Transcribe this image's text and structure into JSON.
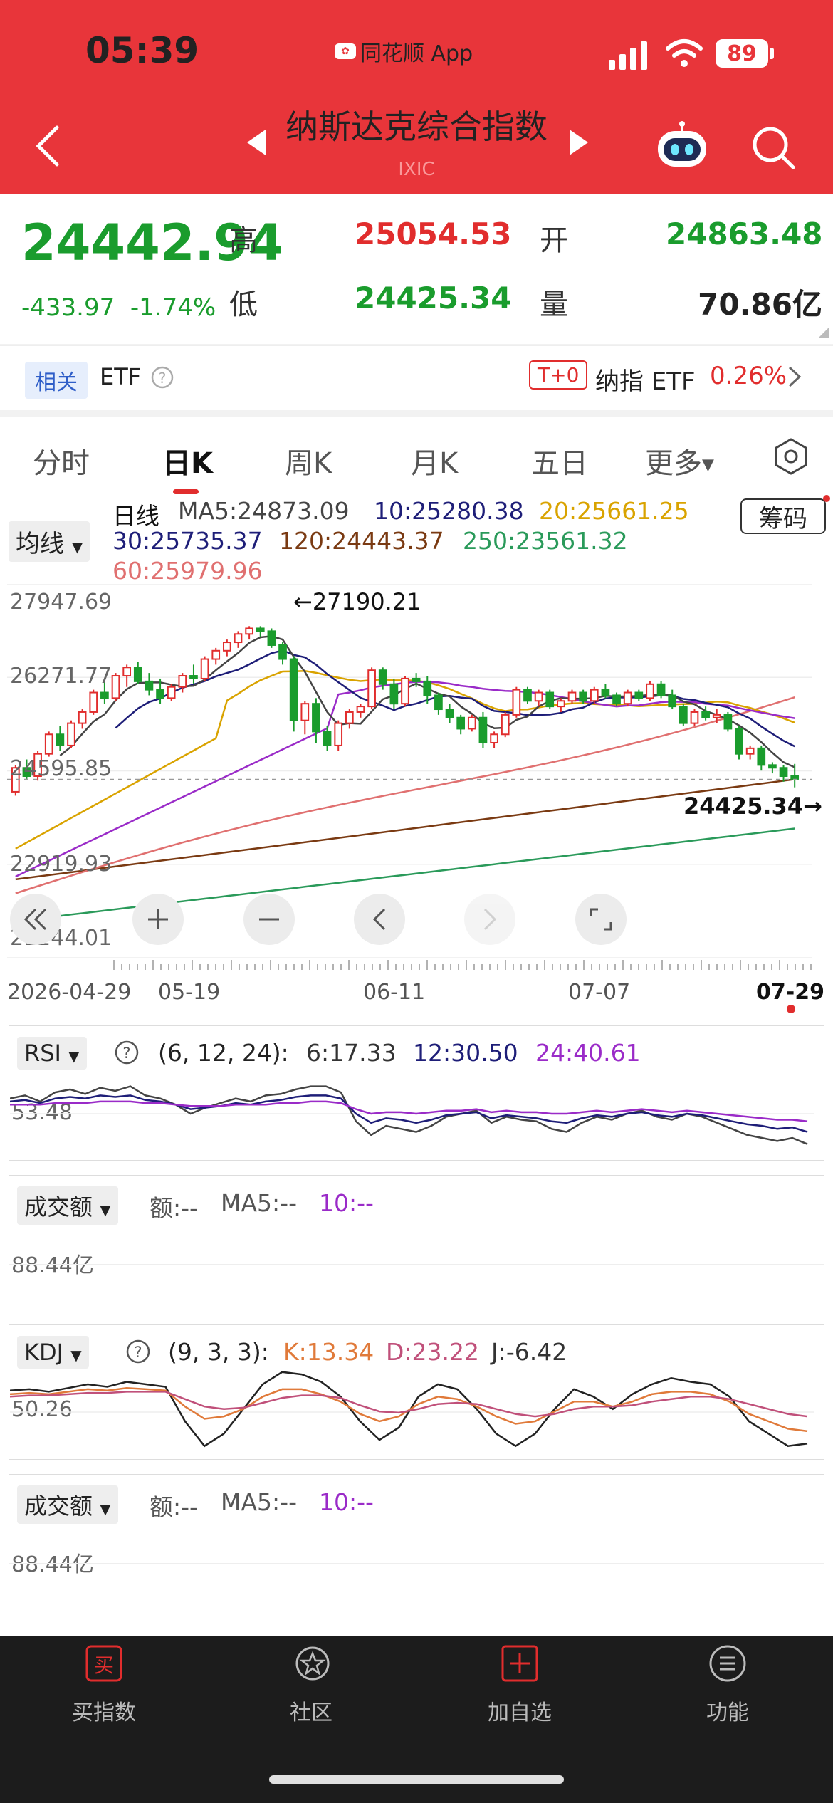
{
  "status_bar": {
    "time": "05:39",
    "app_badge": "同花顺 App",
    "battery": "89"
  },
  "header": {
    "title": "纳斯达克综合指数",
    "subtitle": "IXIC"
  },
  "quote": {
    "price": "24442.94",
    "change": "-433.97",
    "change_pct": "-1.74%",
    "high_label": "高",
    "high": "25054.53",
    "open_label": "开",
    "open": "24863.48",
    "low_label": "低",
    "low": "24425.34",
    "volume_label": "量",
    "volume": "70.86亿"
  },
  "etf_bar": {
    "related": "相关",
    "etf": "ETF",
    "t0": "T+0",
    "name": "纳指 ETF",
    "change": "0.26%"
  },
  "tabs": [
    "分时",
    "日K",
    "周K",
    "月K",
    "五日",
    "更多"
  ],
  "active_tab": "日K",
  "ma_bar": {
    "selector": "均线",
    "period": "日线",
    "ma5": "MA5:24873.09",
    "ma10": "10:25280.38",
    "ma20": "20:25661.25",
    "ma30": "30:25735.37",
    "ma120": "120:24443.37",
    "ma250": "250:23561.32",
    "ma60": "60:25979.96",
    "chips": "筹码"
  },
  "colors": {
    "ma5": "#444444",
    "ma10": "#1e1e78",
    "ma20": "#d9a300",
    "ma30": "#9a2bc8",
    "ma60": "#e07070",
    "ma120": "#7a3a12",
    "ma250": "#2a9a5a",
    "up": "#e12d2d",
    "down": "#1a9c2d"
  },
  "chart_data": [
    {
      "type": "candlestick",
      "y_ticks": [
        "27947.69",
        "26271.77",
        "24595.85",
        "22919.93",
        "21244.01"
      ],
      "x_ticks": [
        "2026-04-29",
        "05-19",
        "06-11",
        "07-07",
        "07-29"
      ],
      "ylim": [
        21244.01,
        27947.69
      ],
      "annotations": {
        "high": "←27190.21",
        "low": "24425.34→"
      },
      "ohlc": [
        [
          24220,
          24700,
          24150,
          24650
        ],
        [
          24650,
          24800,
          24450,
          24500
        ],
        [
          24500,
          24950,
          24420,
          24900
        ],
        [
          24900,
          25300,
          24850,
          25250
        ],
        [
          25250,
          25400,
          24950,
          25050
        ],
        [
          25050,
          25500,
          25000,
          25450
        ],
        [
          25450,
          25700,
          25350,
          25650
        ],
        [
          25650,
          26050,
          25600,
          26000
        ],
        [
          26000,
          26200,
          25800,
          25900
        ],
        [
          25900,
          26350,
          25850,
          26300
        ],
        [
          26300,
          26500,
          26100,
          26450
        ],
        [
          26450,
          26550,
          26150,
          26200
        ],
        [
          26200,
          26350,
          25950,
          26050
        ],
        [
          26050,
          26250,
          25800,
          25900
        ],
        [
          25900,
          26150,
          25850,
          26100
        ],
        [
          26100,
          26350,
          26000,
          26300
        ],
        [
          26300,
          26500,
          26150,
          26250
        ],
        [
          26250,
          26650,
          26200,
          26600
        ],
        [
          26600,
          26800,
          26500,
          26750
        ],
        [
          26750,
          26950,
          26650,
          26900
        ],
        [
          26900,
          27100,
          26800,
          27050
        ],
        [
          27050,
          27190,
          26950,
          27150
        ],
        [
          27150,
          27190,
          27000,
          27100
        ],
        [
          27100,
          27150,
          26800,
          26850
        ],
        [
          26850,
          26900,
          26500,
          26600
        ],
        [
          26600,
          26650,
          25300,
          25500
        ],
        [
          25500,
          25850,
          25250,
          25800
        ],
        [
          25800,
          25900,
          25100,
          25300
        ],
        [
          25300,
          25400,
          24950,
          25050
        ],
        [
          25050,
          25500,
          24950,
          25450
        ],
        [
          25450,
          25700,
          25350,
          25650
        ],
        [
          25650,
          25800,
          25550,
          25750
        ],
        [
          25750,
          26450,
          25700,
          26400
        ],
        [
          26400,
          26450,
          26050,
          26150
        ],
        [
          26150,
          26250,
          25700,
          25800
        ],
        [
          25800,
          26300,
          25750,
          26250
        ],
        [
          26250,
          26350,
          26100,
          26200
        ],
        [
          26200,
          26300,
          25800,
          25950
        ],
        [
          25950,
          26000,
          25600,
          25700
        ],
        [
          25700,
          25800,
          25450,
          25550
        ],
        [
          25550,
          25600,
          25250,
          25350
        ],
        [
          25350,
          25600,
          25300,
          25550
        ],
        [
          25550,
          25650,
          25000,
          25100
        ],
        [
          25100,
          25300,
          25000,
          25250
        ],
        [
          25250,
          25650,
          25200,
          25600
        ],
        [
          25600,
          26100,
          25550,
          26050
        ],
        [
          26050,
          26100,
          25800,
          25850
        ],
        [
          25850,
          26050,
          25750,
          26000
        ],
        [
          26000,
          26050,
          25700,
          25750
        ],
        [
          25750,
          25900,
          25650,
          25850
        ],
        [
          25850,
          26050,
          25800,
          26000
        ],
        [
          26000,
          26050,
          25800,
          25850
        ],
        [
          25850,
          26100,
          25800,
          26050
        ],
        [
          26050,
          26150,
          25900,
          25950
        ],
        [
          25950,
          26000,
          25750,
          25800
        ],
        [
          25800,
          26050,
          25750,
          26000
        ],
        [
          26000,
          26050,
          25850,
          25900
        ],
        [
          25900,
          26200,
          25850,
          26150
        ],
        [
          26150,
          26200,
          25900,
          25950
        ],
        [
          25950,
          26050,
          25700,
          25750
        ],
        [
          25750,
          25800,
          25400,
          25450
        ],
        [
          25450,
          25700,
          25400,
          25650
        ],
        [
          25650,
          25750,
          25500,
          25550
        ],
        [
          25550,
          25700,
          25450,
          25600
        ],
        [
          25600,
          25650,
          25300,
          25350
        ],
        [
          25350,
          25400,
          24800,
          24900
        ],
        [
          24900,
          25050,
          24800,
          25000
        ],
        [
          25000,
          25050,
          24600,
          24700
        ],
        [
          24700,
          24750,
          24550,
          24650
        ],
        [
          24650,
          24700,
          24400,
          24500
        ],
        [
          24500,
          24720,
          24300,
          24450
        ]
      ]
    },
    {
      "type": "line",
      "name": "RSI",
      "params": "(6, 12, 24):",
      "rsi6": "6:17.33",
      "rsi12": "12:30.50",
      "rsi24": "24:40.61",
      "y_label": "53.48",
      "series": [
        {
          "name": "6",
          "values": [
            60,
            62,
            58,
            64,
            66,
            63,
            67,
            65,
            68,
            62,
            60,
            56,
            50,
            54,
            57,
            60,
            58,
            62,
            63,
            66,
            68,
            68,
            64,
            45,
            36,
            42,
            40,
            38,
            42,
            48,
            50,
            52,
            44,
            48,
            46,
            45,
            40,
            38,
            44,
            48,
            46,
            50,
            52,
            48,
            46,
            50,
            48,
            44,
            40,
            36,
            34,
            32,
            34,
            30
          ]
        },
        {
          "name": "12",
          "values": [
            58,
            59,
            57,
            60,
            61,
            60,
            62,
            61,
            62,
            59,
            58,
            56,
            53,
            54,
            55,
            57,
            56,
            58,
            59,
            61,
            62,
            62,
            60,
            50,
            44,
            47,
            46,
            44,
            46,
            49,
            50,
            51,
            47,
            49,
            48,
            47,
            45,
            44,
            47,
            49,
            48,
            50,
            51,
            49,
            48,
            50,
            49,
            47,
            45,
            43,
            42,
            40,
            41,
            38
          ]
        },
        {
          "name": "24",
          "values": [
            56,
            56,
            56,
            57,
            57,
            57,
            58,
            58,
            58,
            57,
            57,
            56,
            55,
            55,
            55,
            56,
            56,
            56,
            57,
            57,
            58,
            58,
            57,
            53,
            50,
            51,
            51,
            50,
            51,
            52,
            52,
            53,
            51,
            52,
            51,
            51,
            50,
            50,
            51,
            52,
            51,
            52,
            53,
            52,
            51,
            52,
            51,
            50,
            49,
            48,
            47,
            46,
            46,
            45
          ]
        }
      ]
    },
    {
      "type": "bar",
      "name": "成交额",
      "label_amount": "额:--",
      "label_ma5": "MA5:--",
      "label_ma10": "10:--",
      "y_label": "88.44亿",
      "values": []
    },
    {
      "type": "line",
      "name": "KDJ",
      "params": "(9, 3, 3):",
      "k": "K:13.34",
      "d": "D:23.22",
      "j": "J:-6.42",
      "y_label": "50.26",
      "series": [
        {
          "name": "J",
          "values": [
            65,
            66,
            64,
            67,
            70,
            68,
            72,
            70,
            68,
            40,
            20,
            30,
            50,
            70,
            80,
            78,
            72,
            60,
            40,
            25,
            35,
            60,
            70,
            66,
            50,
            30,
            20,
            30,
            50,
            66,
            60,
            50,
            62,
            70,
            75,
            72,
            70,
            60,
            40,
            30,
            20,
            22
          ]
        },
        {
          "name": "K",
          "values": [
            62,
            63,
            62,
            64,
            66,
            65,
            67,
            66,
            65,
            52,
            42,
            44,
            50,
            60,
            66,
            66,
            62,
            56,
            46,
            40,
            44,
            54,
            60,
            58,
            52,
            44,
            38,
            40,
            48,
            56,
            56,
            52,
            56,
            62,
            64,
            64,
            62,
            56,
            46,
            40,
            34,
            32
          ]
        },
        {
          "name": "D",
          "values": [
            60,
            61,
            61,
            62,
            63,
            63,
            64,
            64,
            64,
            58,
            52,
            50,
            51,
            55,
            59,
            61,
            61,
            59,
            53,
            48,
            47,
            50,
            54,
            55,
            54,
            50,
            46,
            44,
            46,
            50,
            52,
            52,
            53,
            56,
            58,
            60,
            60,
            58,
            54,
            50,
            46,
            44
          ]
        }
      ]
    },
    {
      "type": "bar",
      "name": "成交额",
      "label_amount": "额:--",
      "label_ma5": "MA5:--",
      "label_ma10": "10:--",
      "y_label": "88.44亿",
      "values": []
    }
  ],
  "nav": {
    "buy": "买指数",
    "community": "社区",
    "add": "加自选",
    "functions": "功能"
  }
}
